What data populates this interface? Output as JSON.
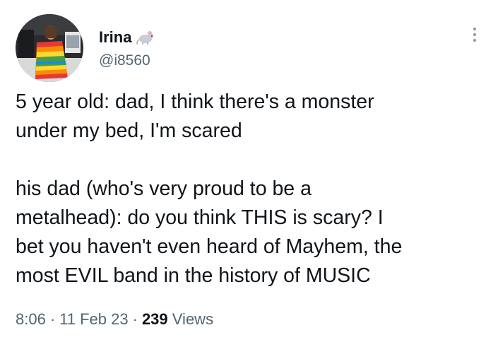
{
  "user": {
    "display_name": "Irina",
    "handle": "@i8560",
    "badge_emoji": "rat-emoji"
  },
  "tweet": {
    "paragraph1": "5 year old: dad, I think there's a monster\nunder my bed, I'm scared",
    "paragraph2": "his dad (who's very proud to be a\nmetalhead): do you think THIS is scary? I\nbet you haven't even heard of Mayhem, the\nmost EVIL band in the history of MUSIC"
  },
  "meta": {
    "time": "8:06",
    "separator": "·",
    "date": "11 Feb 23",
    "views_count": "239",
    "views_label": "Views"
  },
  "icons": {
    "more": "more-options-icon"
  }
}
